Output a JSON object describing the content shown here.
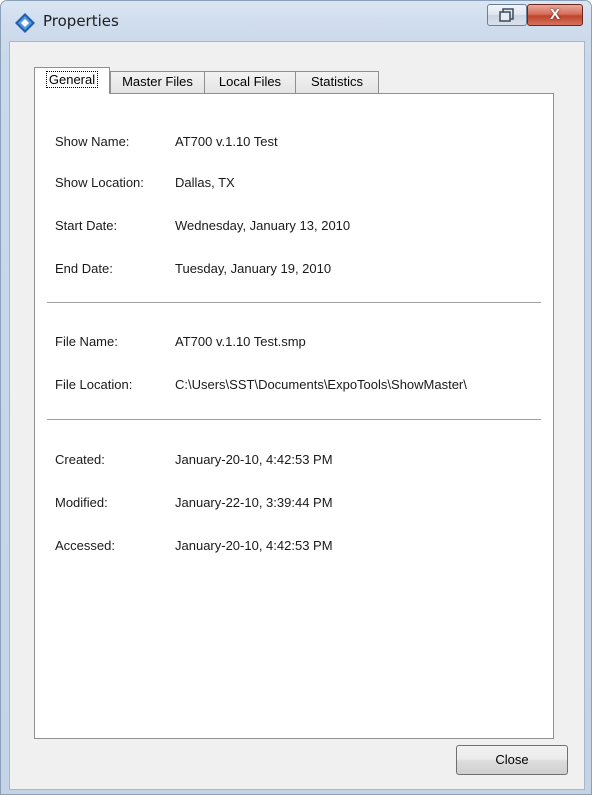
{
  "window": {
    "title": "Properties",
    "close_glyph": "X",
    "icons": {
      "app": "properties-app-icon",
      "restore": "restore-icon",
      "close": "close-icon"
    }
  },
  "tabs": [
    {
      "label": "General",
      "active": true
    },
    {
      "label": "Master Files",
      "active": false
    },
    {
      "label": "Local Files",
      "active": false
    },
    {
      "label": "Statistics",
      "active": false
    }
  ],
  "general": {
    "show_name": {
      "label": "Show Name:",
      "value": "AT700 v.1.10 Test"
    },
    "show_location": {
      "label": "Show Location:",
      "value": "Dallas, TX"
    },
    "start_date": {
      "label": "Start Date:",
      "value": "Wednesday, January 13, 2010"
    },
    "end_date": {
      "label": "End Date:",
      "value": "Tuesday, January 19, 2010"
    },
    "file_name": {
      "label": "File Name:",
      "value": "AT700 v.1.10 Test.smp"
    },
    "file_location": {
      "label": "File Location:",
      "value": "C:\\Users\\SST\\Documents\\ExpoTools\\ShowMaster\\"
    },
    "created": {
      "label": "Created:",
      "value": "January-20-10, 4:42:53 PM"
    },
    "modified": {
      "label": "Modified:",
      "value": "January-22-10, 3:39:44 PM"
    },
    "accessed": {
      "label": "Accessed:",
      "value": "January-20-10, 4:42:53 PM"
    }
  },
  "footer": {
    "close_label": "Close"
  },
  "colors": {
    "title_close_red": "#c0432b",
    "panel_bg": "#ffffff",
    "dialog_bg": "#f0f0f0"
  }
}
